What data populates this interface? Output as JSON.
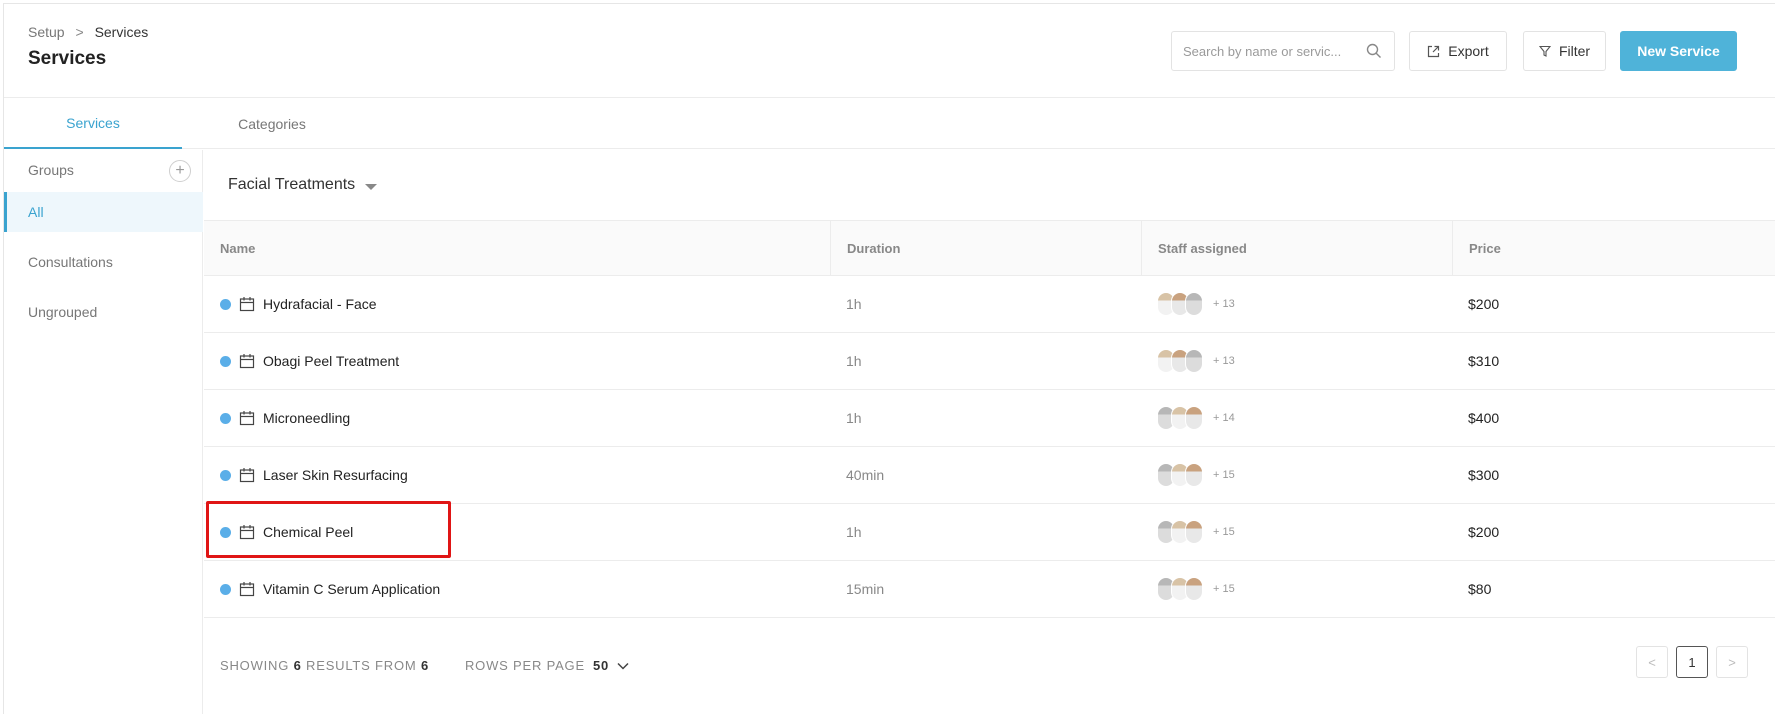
{
  "breadcrumb": {
    "root": "Setup",
    "separator": ">",
    "current": "Services"
  },
  "page_title": "Services",
  "search": {
    "placeholder": "Search by name or servic..."
  },
  "buttons": {
    "export": "Export",
    "filter": "Filter",
    "new_service": "New Service"
  },
  "tabs": [
    {
      "label": "Services",
      "active": true
    },
    {
      "label": "Categories",
      "active": false
    }
  ],
  "sidebar": {
    "groups_label": "Groups",
    "items": [
      {
        "label": "All",
        "active": true
      },
      {
        "label": "Consultations"
      },
      {
        "label": "Ungrouped"
      }
    ]
  },
  "category": {
    "selected": "Facial Treatments"
  },
  "table": {
    "headers": {
      "name": "Name",
      "duration": "Duration",
      "staff": "Staff assigned",
      "price": "Price"
    },
    "rows": [
      {
        "name": "Hydrafacial - Face",
        "duration": "1h",
        "staff_more": "+ 13",
        "price": "$200"
      },
      {
        "name": "Obagi Peel Treatment",
        "duration": "1h",
        "staff_more": "+ 13",
        "price": "$310"
      },
      {
        "name": "Microneedling",
        "duration": "1h",
        "staff_more": "+ 14",
        "price": "$400"
      },
      {
        "name": "Laser Skin Resurfacing",
        "duration": "40min",
        "staff_more": "+ 15",
        "price": "$300"
      },
      {
        "name": "Chemical Peel",
        "duration": "1h",
        "staff_more": "+ 15",
        "price": "$200"
      },
      {
        "name": "Vitamin C Serum Application",
        "duration": "15min",
        "staff_more": "+ 15",
        "price": "$80"
      }
    ]
  },
  "footer": {
    "showing_prefix": "SHOWING",
    "shown": "6",
    "results_from": "RESULTS FROM",
    "total": "6",
    "rows_per_page_label": "ROWS PER PAGE",
    "rows_per_page": "50"
  },
  "pagination": {
    "prev": "<",
    "current": "1",
    "next": ">"
  },
  "colors": {
    "accent": "#3aa3cf",
    "primary_button": "#4fb3d9",
    "status_dot": "#5aaee8",
    "highlight": "#e01515"
  }
}
